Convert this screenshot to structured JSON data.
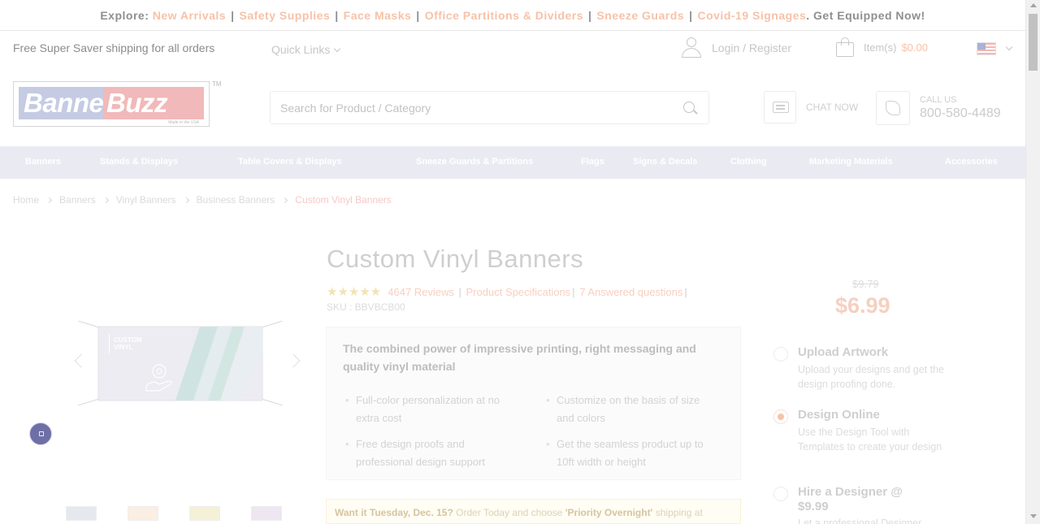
{
  "promo": {
    "explore": "Explore:",
    "links": [
      "New Arrivals",
      "Safety Supplies",
      "Face Masks",
      "Office Partitions & Dividers",
      "Sneeze Guards",
      "Covid-19 Signages"
    ],
    "suffix": ". Get Equipped Now!"
  },
  "header": {
    "shipping_note": "Free Super Saver shipping for all orders",
    "quick_links": "Quick Links",
    "login": "Login / Register",
    "cart_label": "Item(s)",
    "cart_total": "$0.00",
    "chat_now": "CHAT NOW",
    "call_label": "CALL US",
    "phone": "800-580-4489"
  },
  "logo": {
    "part1": "Banner",
    "part2": "Buzz",
    "tagline": "Made in the USA",
    "tm": "TM"
  },
  "search": {
    "placeholder": "Search for Product / Category"
  },
  "nav": {
    "items": [
      "Banners",
      "Stands & Displays",
      "Table Covers & Displays",
      "Sneeze Guards & Partitions",
      "Flags",
      "Signs & Decals",
      "Clothing",
      "Marketing Materials",
      "Accessories"
    ]
  },
  "breadcrumb": [
    "Home",
    "Banners",
    "Vinyl Banners",
    "Business Banners",
    "Custom Vinyl Banners"
  ],
  "product": {
    "title": "Custom Vinyl Banners",
    "rating": 4.5,
    "stars": "★★★★★",
    "reviews": "4647 Reviews",
    "specs_link": "Product Specifications",
    "questions_link": "7 Answered questions",
    "sku": "SKU : BBVBCB00",
    "banner_text_1": "CUSTOM",
    "banner_text_2": "VINYL",
    "feature_heading": "The combined power of impressive printing, right messaging and quality vinyl material",
    "features": [
      "Full-color personalization at no extra cost",
      "Customize on the basis of size and colors",
      "Free design proofs and professional design support",
      "Get the seamless product up to 10ft width or height"
    ],
    "delivery_lead": "Want it Tuesday, Dec. 15?",
    "delivery_mid": " Order Today and choose ",
    "delivery_option": "'Priority Overnight'",
    "delivery_tail": " shipping at"
  },
  "pricing": {
    "old_price": "$9.79",
    "price": "$6.99",
    "options": [
      {
        "title": "Upload Artwork",
        "desc": "Upload your designs and get the design proofing done.",
        "selected": false
      },
      {
        "title": "Design Online",
        "desc": "Use the Design Tool with Templates to create your design",
        "selected": true
      },
      {
        "title": "Hire a Designer @ $9.99",
        "desc": "Let a professional Designer",
        "selected": false
      }
    ]
  },
  "colors": {
    "accent": "#f7c2a8",
    "nav_bg": "#eaebf2",
    "chat_bubble": "#6f6fa7"
  }
}
